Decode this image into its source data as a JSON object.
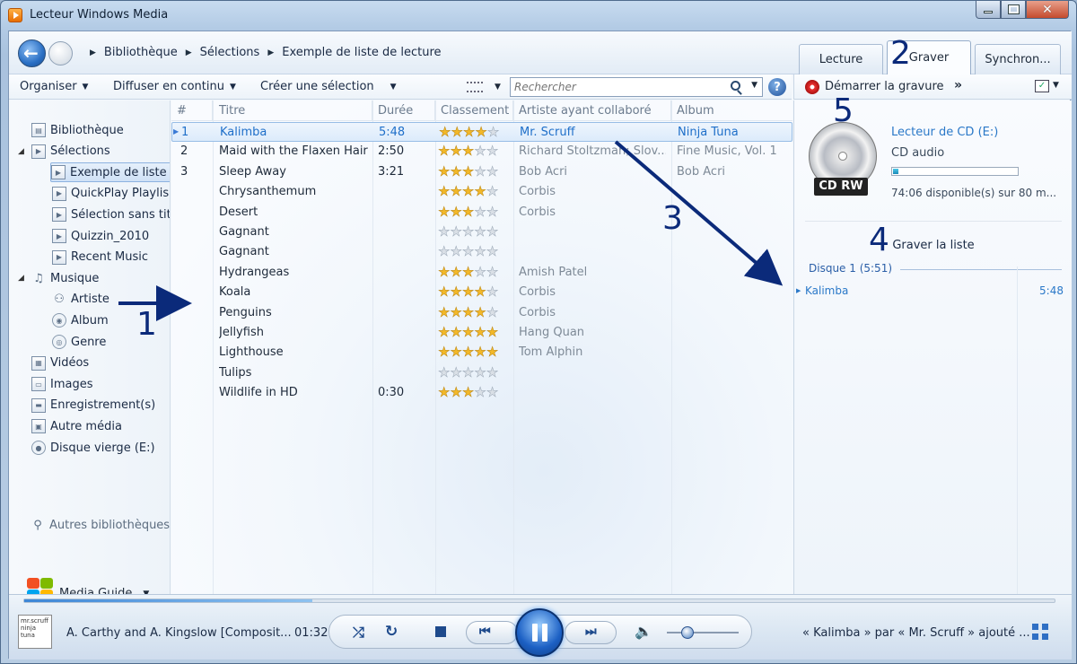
{
  "window": {
    "title": "Lecteur Windows Media"
  },
  "breadcrumb": [
    "Bibliothèque",
    "Sélections",
    "Exemple de liste de lecture"
  ],
  "tabs": [
    {
      "label": "Lecture",
      "active": false
    },
    {
      "label": "Graver",
      "active": true
    },
    {
      "label": "Synchron...",
      "active": false
    }
  ],
  "toolbar": {
    "organize": "Organiser",
    "stream": "Diffuser en continu",
    "create_playlist": "Créer une sélection",
    "search_placeholder": "Rechercher",
    "help": "?"
  },
  "burn_toolbar": {
    "start_burn": "Démarrer la gravure",
    "more": "»"
  },
  "sidebar": {
    "items": [
      {
        "label": "Bibliothèque",
        "icon": "library-icon",
        "level": 0,
        "expander": ""
      },
      {
        "label": "Sélections",
        "icon": "playlist-icon",
        "level": 0,
        "expander": "◢"
      },
      {
        "label": "Exemple de liste",
        "icon": "playlist-icon",
        "level": 1,
        "expander": "",
        "selected": true
      },
      {
        "label": "QuickPlay Playlis",
        "icon": "playlist-icon",
        "level": 1,
        "expander": ""
      },
      {
        "label": "Sélection sans tit",
        "icon": "playlist-icon",
        "level": 1,
        "expander": ""
      },
      {
        "label": "Quizzin_2010",
        "icon": "playlist-icon",
        "level": 1,
        "expander": ""
      },
      {
        "label": "Recent Music",
        "icon": "playlist-icon",
        "level": 1,
        "expander": ""
      },
      {
        "label": "Musique",
        "icon": "music-note-icon",
        "level": 0,
        "expander": "◢"
      },
      {
        "label": "Artiste",
        "icon": "artist-icon",
        "level": 1,
        "expander": ""
      },
      {
        "label": "Album",
        "icon": "album-icon",
        "level": 1,
        "expander": ""
      },
      {
        "label": "Genre",
        "icon": "genre-icon",
        "level": 1,
        "expander": ""
      },
      {
        "label": "Vidéos",
        "icon": "video-icon",
        "level": 0,
        "expander": ""
      },
      {
        "label": "Images",
        "icon": "picture-icon",
        "level": 0,
        "expander": ""
      },
      {
        "label": "Enregistrement(s)",
        "icon": "tv-icon",
        "level": 0,
        "expander": ""
      },
      {
        "label": "Autre média",
        "icon": "other-media-icon",
        "level": 0,
        "expander": ""
      },
      {
        "label": "Disque vierge (E:)",
        "icon": "blank-disc-icon",
        "level": 0,
        "expander": ""
      }
    ],
    "other_libraries": "Autres bibliothèques",
    "media_guide": "Media Guide"
  },
  "table": {
    "columns": [
      "#",
      "Titre",
      "Durée",
      "Classement",
      "Artiste ayant collaboré",
      "Album"
    ],
    "rows": [
      {
        "num": "1",
        "title": "Kalimba",
        "duration": "5:48",
        "rating": 3.5,
        "artist": "Mr. Scruff",
        "album": "Ninja Tuna",
        "selected": true
      },
      {
        "num": "2",
        "title": "Maid with the Flaxen Hair",
        "duration": "2:50",
        "rating": 3,
        "artist": "Richard Stoltzman; Slov...",
        "album": "Fine Music, Vol. 1"
      },
      {
        "num": "3",
        "title": "Sleep Away",
        "duration": "3:21",
        "rating": 3,
        "artist": "Bob Acri",
        "album": "Bob Acri"
      },
      {
        "num": "",
        "title": "Chrysanthemum",
        "duration": "",
        "rating": 4,
        "artist": "Corbis",
        "album": ""
      },
      {
        "num": "",
        "title": "Desert",
        "duration": "",
        "rating": 3,
        "artist": "Corbis",
        "album": ""
      },
      {
        "num": "",
        "title": "Gagnant",
        "duration": "",
        "rating": 0,
        "artist": "",
        "album": ""
      },
      {
        "num": "",
        "title": "Gagnant",
        "duration": "",
        "rating": 0,
        "artist": "",
        "album": ""
      },
      {
        "num": "",
        "title": "Hydrangeas",
        "duration": "",
        "rating": 3,
        "artist": "Amish Patel",
        "album": ""
      },
      {
        "num": "",
        "title": "Koala",
        "duration": "",
        "rating": 4,
        "artist": "Corbis",
        "album": ""
      },
      {
        "num": "",
        "title": "Penguins",
        "duration": "",
        "rating": 4,
        "artist": "Corbis",
        "album": ""
      },
      {
        "num": "",
        "title": "Jellyfish",
        "duration": "",
        "rating": 5,
        "artist": "Hang Quan",
        "album": ""
      },
      {
        "num": "",
        "title": "Lighthouse",
        "duration": "",
        "rating": 5,
        "artist": "Tom Alphin",
        "album": ""
      },
      {
        "num": "",
        "title": "Tulips",
        "duration": "",
        "rating": 0,
        "artist": "",
        "album": ""
      },
      {
        "num": "",
        "title": "Wildlife in HD",
        "duration": "0:30",
        "rating": 3,
        "artist": "",
        "album": ""
      }
    ]
  },
  "burn_panel": {
    "cd_label": "CD RW",
    "drive_name": "Lecteur de CD (E:)",
    "drive_type": "CD audio",
    "capacity_used_fraction": 0.04,
    "capacity_text": "74:06 disponible(s) sur 80 m...",
    "list_title": "Graver la liste",
    "disc_header": "Disque 1 (5:51)",
    "items": [
      {
        "title": "Kalimba",
        "duration": "5:48"
      }
    ]
  },
  "player": {
    "album_art_text": "mr.scruff ninja tuna",
    "now_playing": "A. Carthy and A. Kingslow [Composit...",
    "elapsed": "01:32",
    "seek_fraction": 0.28,
    "status": "« Kalimba » par « Mr. Scruff » ajouté ..."
  },
  "annotations": [
    "1",
    "2",
    "3",
    "4",
    "5"
  ],
  "colors": {
    "accent": "#2a78c8",
    "annotation": "#0b2a7a",
    "star_on": "#f2b829"
  }
}
